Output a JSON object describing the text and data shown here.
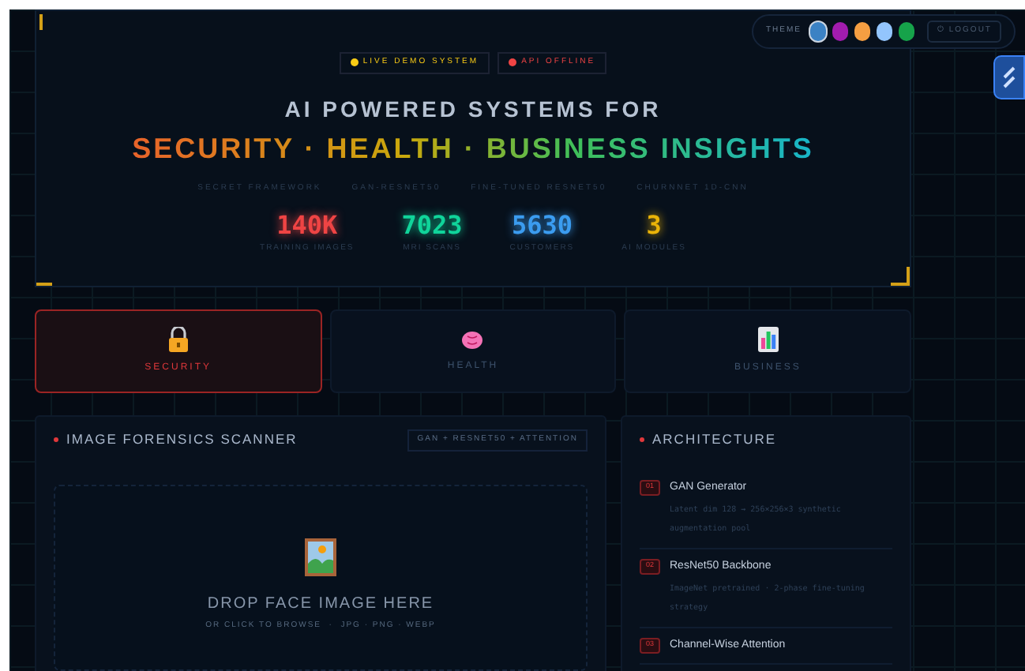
{
  "theme_bar": {
    "label": "THEME",
    "swatches": [
      {
        "color": "#3b82c4",
        "selected": true
      },
      {
        "color": "#a21caf",
        "selected": false
      },
      {
        "color": "#f59e42",
        "selected": false
      },
      {
        "color": "#93c5fd",
        "selected": false
      },
      {
        "color": "#16a34a",
        "selected": false
      }
    ],
    "logout": "⏻ LOGOUT"
  },
  "hero": {
    "badges": [
      {
        "label": "LIVE DEMO SYSTEM",
        "color": "#facc15"
      },
      {
        "label": "API OFFLINE",
        "color": "#ef4444"
      }
    ],
    "title": "AI POWERED SYSTEMS FOR",
    "headline": "SECURITY · HEALTH · BUSINESS INSIGHTS",
    "tech": [
      "SECRET FRAMEWORK",
      "GAN-RESNET50",
      "FINE-TUNED RESNET50",
      "CHURNNET 1D-CNN"
    ],
    "stats": [
      {
        "value": "140K",
        "label": "TRAINING IMAGES",
        "color": "#ef4444"
      },
      {
        "value": "7023",
        "label": "MRI SCANS",
        "color": "#10d49a"
      },
      {
        "value": "5630",
        "label": "CUSTOMERS",
        "color": "#3b9cf0"
      },
      {
        "value": "3",
        "label": "AI MODULES",
        "color": "#eab308"
      }
    ]
  },
  "modules": [
    {
      "kind": "lock",
      "label": "SECURITY",
      "selected": true
    },
    {
      "kind": "brain",
      "label": "HEALTH",
      "selected": false
    },
    {
      "kind": "chart",
      "label": "BUSINESS",
      "selected": false
    }
  ],
  "scanner": {
    "title": "IMAGE FORENSICS SCANNER",
    "tag": "GAN + RESNET50 + ATTENTION",
    "drop_title": "DROP FACE IMAGE HERE",
    "drop_hint": "OR CLICK TO BROWSE  ·  JPG · PNG · WEBP"
  },
  "architecture": {
    "title": "ARCHITECTURE",
    "items": [
      {
        "number": "01",
        "name": "GAN Generator",
        "description": "Latent dim 128 → 256×256×3 synthetic augmentation pool"
      },
      {
        "number": "02",
        "name": "ResNet50 Backbone",
        "description": "ImageNet pretrained · 2-phase fine-tuning strategy"
      },
      {
        "number": "03",
        "name": "Channel-Wise Attention"
      }
    ]
  }
}
